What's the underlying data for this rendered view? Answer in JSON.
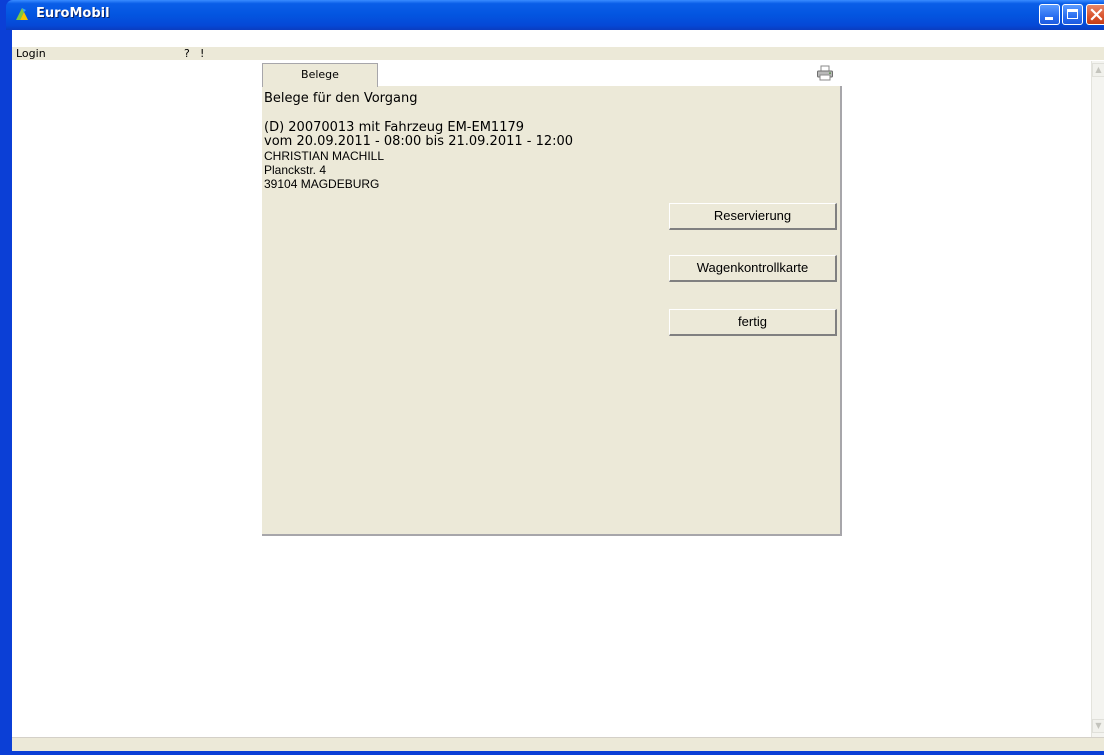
{
  "window": {
    "title": "EuroMobil"
  },
  "menu": {
    "login": "Login",
    "help": "?",
    "bang": "!"
  },
  "tab": {
    "label": "Belege"
  },
  "panel": {
    "heading": "Belege für den Vorgang",
    "lines": [
      "(D) 20070013 mit Fahrzeug EM-EM1179",
      "vom 20.09.2011 - 08:00 bis 21.09.2011 - 12:00",
      "CHRISTIAN  MACHILL",
      "Planckstr. 4",
      "39104 MAGDEBURG"
    ]
  },
  "buttons": {
    "reservierung": "Reservierung",
    "wagenkontrollkarte": "Wagenkontrollkarte",
    "fertig": "fertig"
  },
  "icons": {
    "app": "euromobil-app-icon",
    "printer": "printer-icon"
  },
  "colors": {
    "titlebar": "#0355e0",
    "panel": "#ece9d8",
    "close": "#d9532c"
  }
}
